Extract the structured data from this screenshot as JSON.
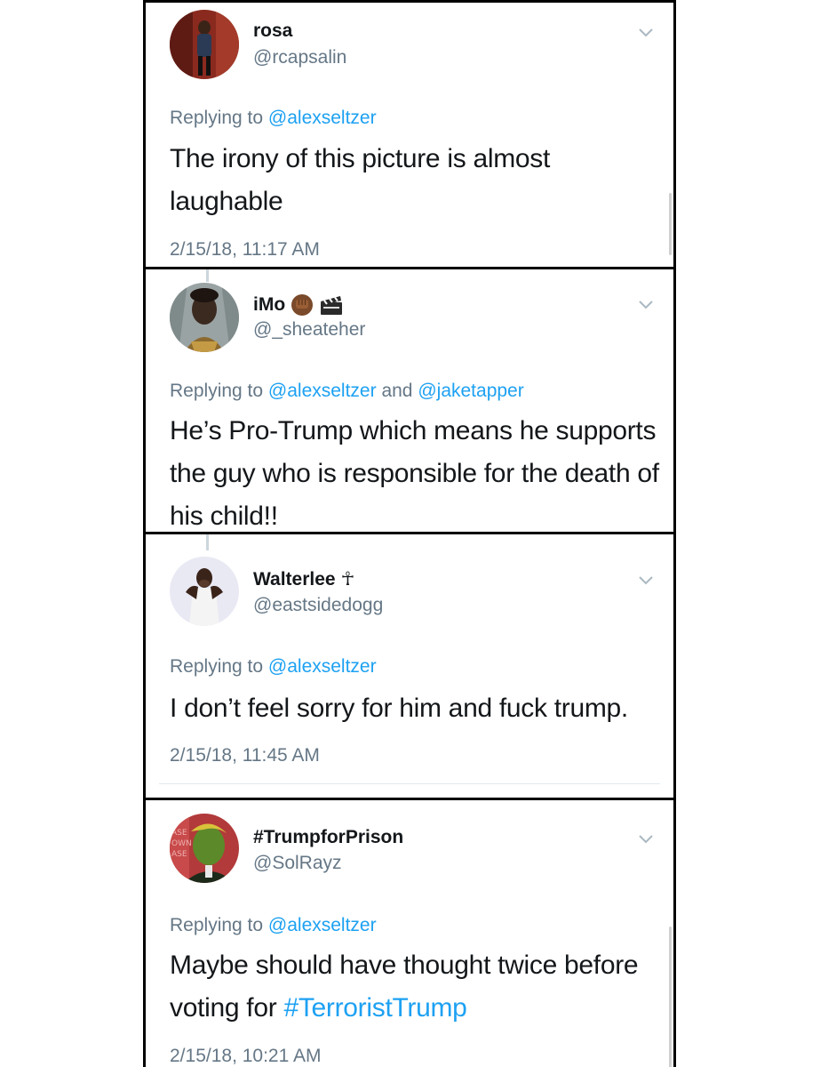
{
  "tweets": [
    {
      "name": "rosa",
      "handle": "@rcapsalin",
      "reply_prefix": "Replying to",
      "reply_to": "@alexseltzer",
      "text": "The irony of this picture is almost laughable",
      "time": "2/15/18, 11:17 AM"
    },
    {
      "name": "iMo",
      "name_emoji": [
        "raised-fist-icon",
        "clapper-board-icon"
      ],
      "handle": "@_sheateher",
      "reply_prefix": "Replying to",
      "reply_to": "@alexseltzer",
      "reply_and": "and",
      "reply_to_2": "@jaketapper",
      "text": "He’s Pro-Trump which means he supports the guy who is responsible for the death of his child!!"
    },
    {
      "name": "Walterlee",
      "name_symbol": "☥",
      "handle": "@eastsidedogg",
      "reply_prefix": "Replying to",
      "reply_to": "@alexseltzer",
      "text": "I don’t feel sorry for him and fuck trump.",
      "time": "2/15/18, 11:45 AM"
    },
    {
      "name": "#TrumpforPrison",
      "handle": "@SolRayz",
      "reply_prefix": "Replying to",
      "reply_to": "@alexseltzer",
      "text_before": "Maybe should have thought twice before voting for",
      "hashtag": "#TerroristTrump",
      "time": "2/15/18, 10:21 AM"
    }
  ],
  "colors": {
    "link": "#1da1f2",
    "secondary": "#657786",
    "primary": "#14171a",
    "border": "#000000"
  }
}
